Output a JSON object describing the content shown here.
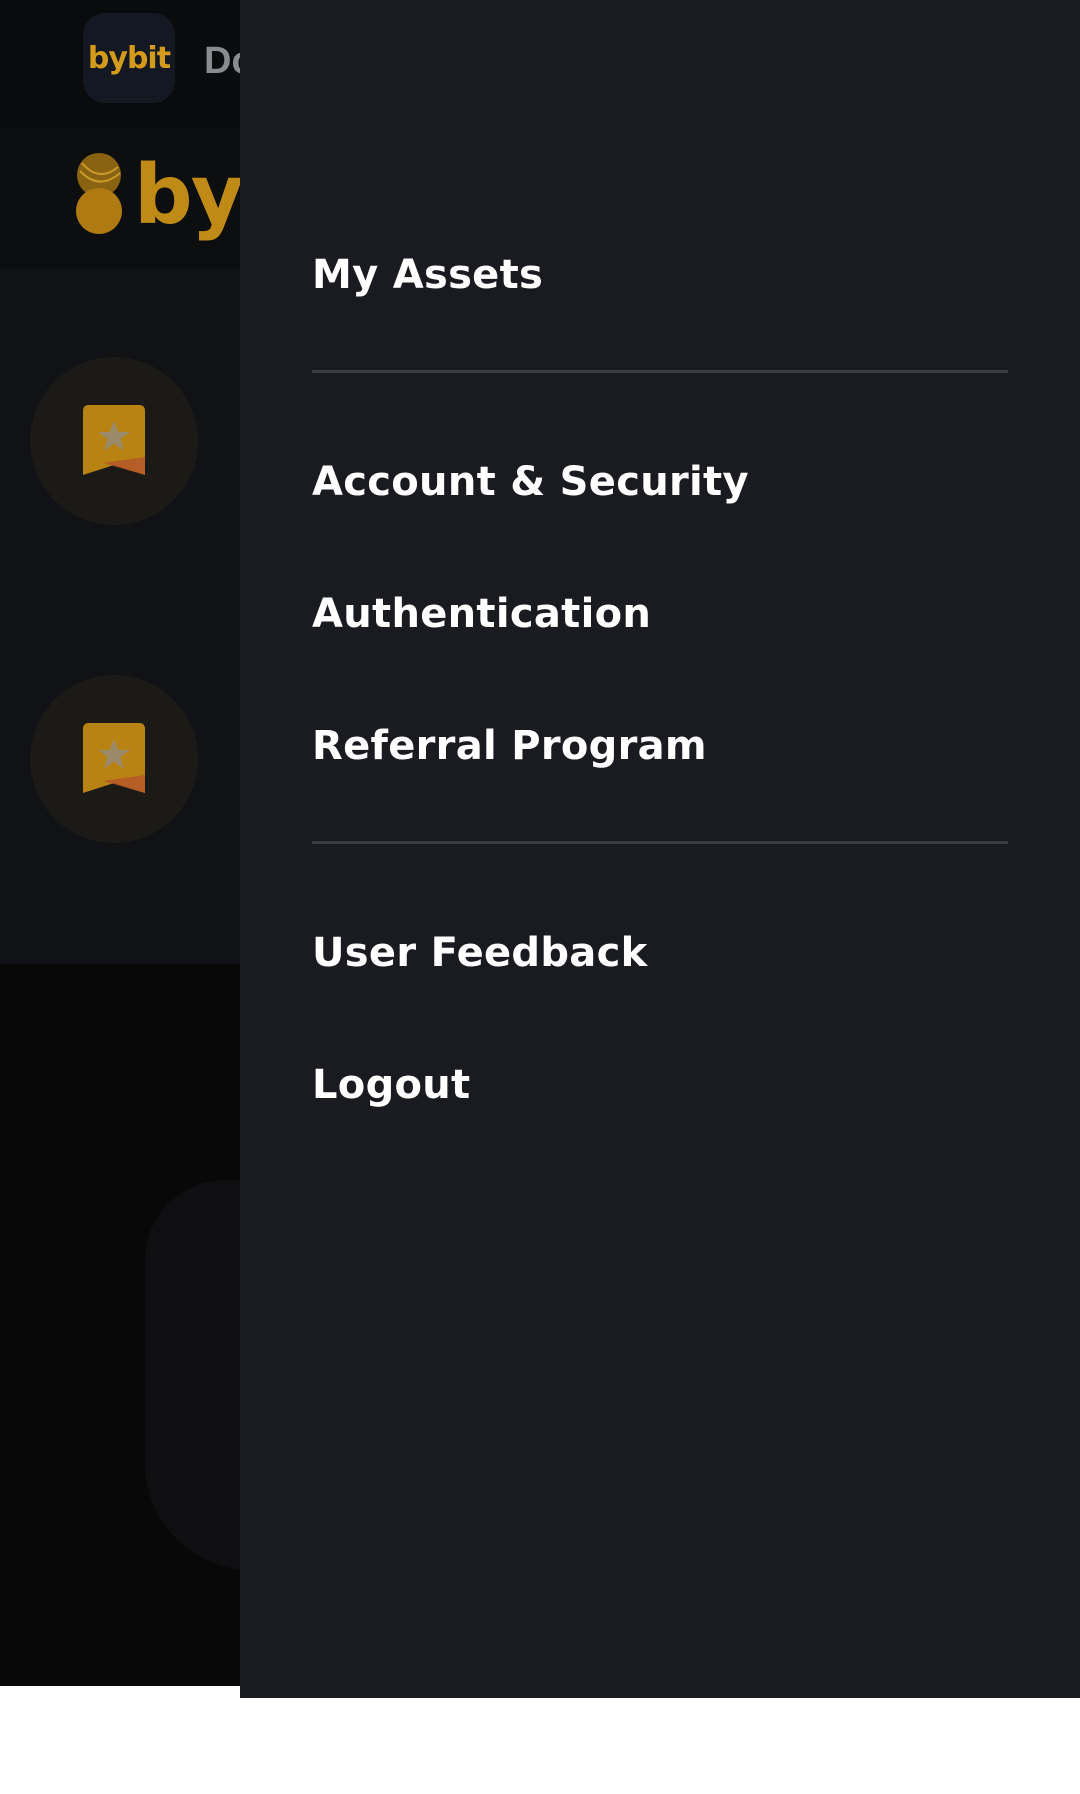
{
  "background_app": {
    "app_icon_label": "bybit",
    "title_fragment": "Do",
    "brand_word": "byb",
    "icons": [
      "logo-mark-icon",
      "bookmark-star-icon",
      "bookmark-star-icon"
    ]
  },
  "drawer": {
    "items": [
      {
        "label": "My Assets"
      },
      {
        "label": "Account & Security"
      },
      {
        "label": "Authentication"
      },
      {
        "label": "Referral Program"
      },
      {
        "label": "User Feedback"
      },
      {
        "label": "Logout"
      }
    ]
  },
  "colors": {
    "drawer_bg": "#1a1b20",
    "divider": "#3b3d44",
    "brand_gold": "#d49a1a",
    "text": "#ffffff"
  }
}
